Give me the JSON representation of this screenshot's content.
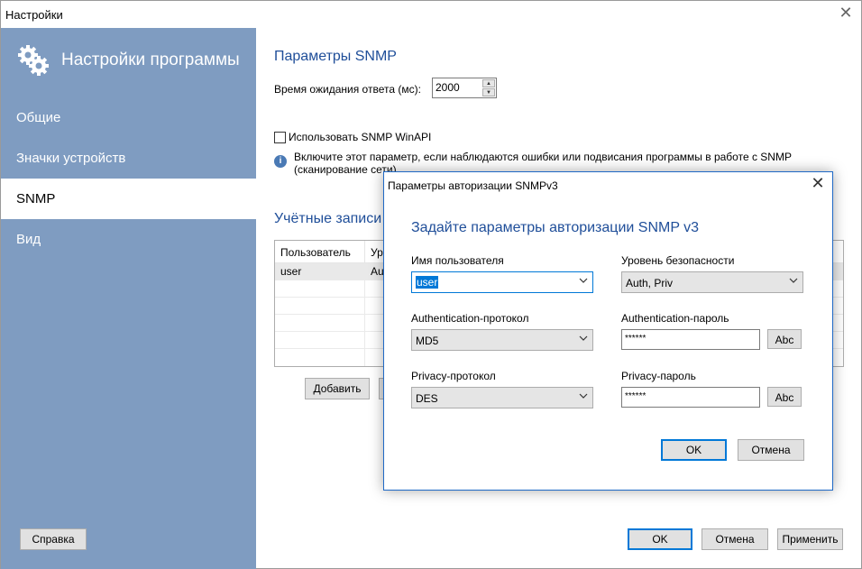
{
  "window": {
    "title": "Настройки"
  },
  "sidebar": {
    "title": "Настройки программы",
    "items": [
      {
        "label": "Общие",
        "active": false
      },
      {
        "label": "Значки устройств",
        "active": false
      },
      {
        "label": "SNMP",
        "active": true
      },
      {
        "label": "Вид",
        "active": false
      }
    ],
    "help_label": "Справка"
  },
  "snmp": {
    "title": "Параметры SNMP",
    "timeout_label": "Время ожидания ответа (мс):",
    "timeout_value": "2000",
    "winapi_label": "Использовать SNMP WinAPI",
    "winapi_checked": false,
    "info_line1": "Включите этот параметр, если наблюдаются ошибки или подвисания программы в работе с SNMP",
    "info_line2": "(сканирование сети)",
    "accounts_title": "Учётные записи S",
    "table": {
      "columns": [
        "Пользователь",
        "Ур"
      ],
      "rows": [
        {
          "user": "user",
          "level": "Au"
        }
      ]
    },
    "add_label": "Добавить"
  },
  "footer": {
    "ok": "OK",
    "cancel": "Отмена",
    "apply": "Применить"
  },
  "dialog": {
    "title": "Параметры авторизации SNMPv3",
    "heading": "Задайте параметры авторизации SNMP v3",
    "username_label": "Имя пользователя",
    "username_value": "user",
    "security_label": "Уровень безопасности",
    "security_value": "Auth, Priv",
    "auth_proto_label": "Authentication-протокол",
    "auth_proto_value": "MD5",
    "auth_pwd_label": "Authentication-пароль",
    "auth_pwd_value": "******",
    "priv_proto_label": "Privacy-протокол",
    "priv_proto_value": "DES",
    "priv_pwd_label": "Privacy-пароль",
    "priv_pwd_value": "******",
    "abc_label": "Abc",
    "ok": "OK",
    "cancel": "Отмена"
  },
  "colors": {
    "sidebar": "#7f9cc1",
    "accent": "#1f4e99",
    "focus": "#0078d7"
  },
  "icons": {
    "sidebar": "gears-icon",
    "info": "info-icon",
    "close": "close-icon",
    "dropdown": "chevron-down-icon"
  }
}
